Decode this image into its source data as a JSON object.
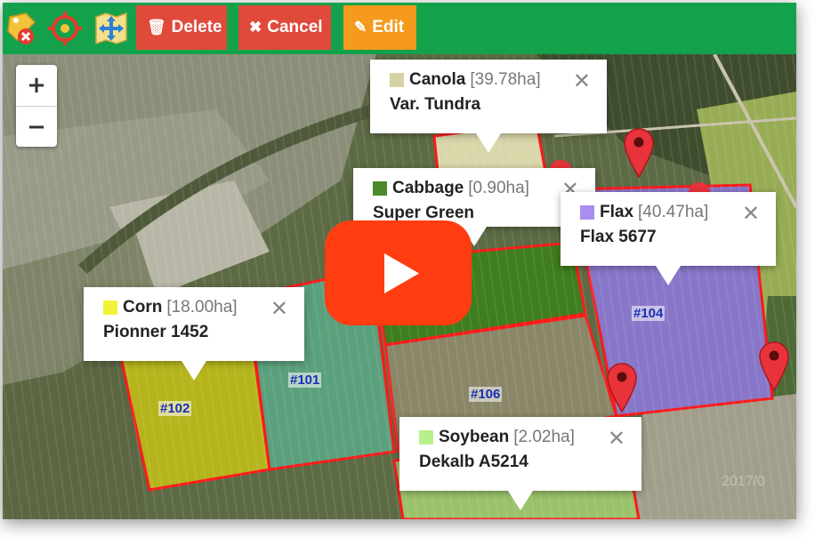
{
  "toolbar": {
    "delete_label": "Delete",
    "cancel_label": "Cancel",
    "edit_label": "Edit",
    "delete_icon": "trash-icon",
    "cancel_icon": "x-icon",
    "edit_icon": "edit-icon",
    "colors": {
      "bar": "#13a24b",
      "delete": "#e04a3b",
      "cancel": "#e04a3b",
      "edit": "#f59a1d"
    }
  },
  "zoom": {
    "in": "+",
    "out": "−"
  },
  "popups": [
    {
      "crop": "Canola",
      "area": "[39.78ha]",
      "variety": "Var. Tundra",
      "swatch": "#d6d1a3"
    },
    {
      "crop": "Cabbage",
      "area": "[0.90ha]",
      "variety": "Super Green",
      "swatch": "#4a8a2a"
    },
    {
      "crop": "Flax",
      "area": "[40.47ha]",
      "variety": "Flax 5677",
      "swatch": "#a88ef0"
    },
    {
      "crop": "Corn",
      "area": "[18.00ha]",
      "variety": "Pionner 1452",
      "swatch": "#f2f23a"
    },
    {
      "crop": "Soybean",
      "area": "[2.02ha]",
      "variety": "Dekalb A5214",
      "swatch": "#b8f08e"
    }
  ],
  "close_glyph": "✕",
  "field_labels": [
    "#102",
    "#101",
    "#106",
    "#104"
  ],
  "watermark": "2017/0"
}
